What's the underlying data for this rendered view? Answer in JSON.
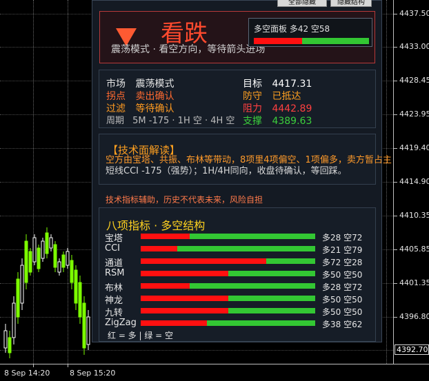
{
  "price_axis": {
    "labels": [
      "4437.50",
      "4433.00",
      "4428.45",
      "4423.95",
      "4419.40",
      "4414.90",
      "4410.35",
      "4405.85",
      "4401.35",
      "4396.80"
    ],
    "current_price": "4392.70"
  },
  "time_axis": {
    "labels": [
      "8 Sep 14:20",
      "8 Sep 15:20"
    ]
  },
  "toolbar": {
    "btn_show_all": "全部隐藏",
    "btn_hide_struct": "隐藏结构"
  },
  "signal": {
    "title": "看跌",
    "subtitle": "震荡模式 · 看空方向，等待箭头进场",
    "arrow_color": "#ff5a32",
    "mini_label": "多空面板  多42 空58",
    "long_pct": 42,
    "short_pct": 58
  },
  "info": {
    "market_label": "市场",
    "market_value": "震荡模式",
    "inflection_label": "拐点",
    "inflection_value": "卖出确认",
    "filter_label": "过滤",
    "filter_value": "等待确认",
    "period_label": "周期",
    "period_value": "5M -175 · 1H 空 · 4H 空",
    "target_label": "目标",
    "target_value": "4417.31",
    "defense_label": "防守",
    "defense_value": "已抵达",
    "resistance_label": "阻力",
    "resistance_value": "4442.89",
    "support_label": "支撑",
    "support_value": "4389.63"
  },
  "analysis": {
    "title": "【技术面解读】",
    "line1": "空方由宝塔、共振、布林等带动，8项里4项偏空、1项偏多，卖方暂占主",
    "line2": "短线CCI -175（强势）；1H/4H同向，收盘待确认，等回踩。"
  },
  "disclaimer": "技术指标辅助，历史不代表未来，风险自担",
  "indicators": {
    "title": "八项指标 · 多空结构",
    "items": [
      {
        "name": "宝塔",
        "long": 28,
        "short": 72,
        "label": "多28 空72"
      },
      {
        "name": "CCI",
        "long": 21,
        "short": 79,
        "label": "多21 空79"
      },
      {
        "name": "通道",
        "long": 72,
        "short": 28,
        "label": "多72 空28"
      },
      {
        "name": "RSM",
        "long": 50,
        "short": 50,
        "label": "多50 空50"
      },
      {
        "name": "布林",
        "long": 28,
        "short": 72,
        "label": "多28 空72"
      },
      {
        "name": "神龙",
        "long": 50,
        "short": 50,
        "label": "多50 空50"
      },
      {
        "name": "九转",
        "long": 50,
        "short": 50,
        "label": "多50 空50"
      },
      {
        "name": "ZigZag",
        "long": 38,
        "short": 62,
        "label": "多38 空62"
      }
    ],
    "legend": "红 = 多  |  绿 = 空"
  },
  "colors": {
    "bull_red": "#ff1010",
    "bear_green": "#33c733",
    "candle_up": "#ffffff",
    "candle_down": "#7CFC00"
  }
}
